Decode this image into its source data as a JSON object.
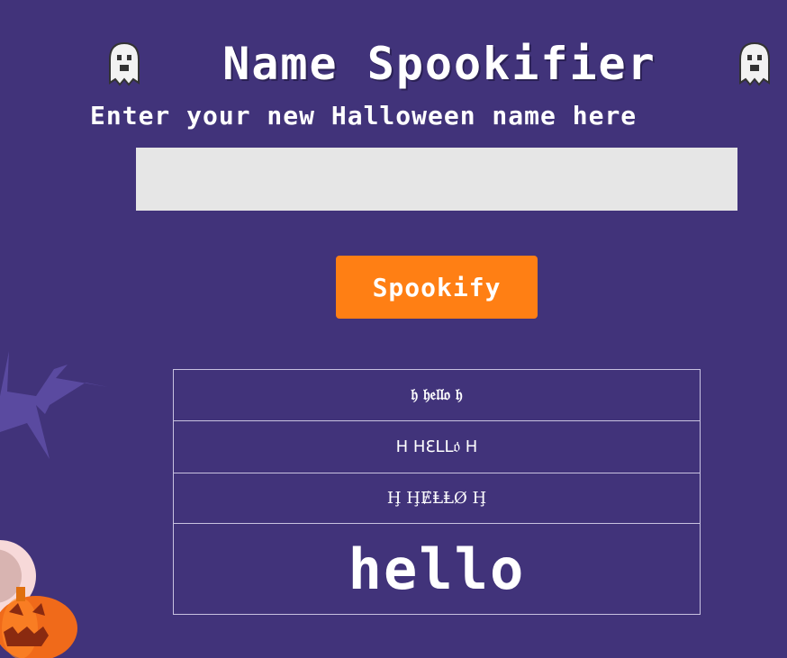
{
  "header": {
    "title": "Name Spookifier",
    "left_icon": "ghost-icon",
    "right_icon": "ghost-icon",
    "subtitle": "Enter your new Halloween name here"
  },
  "form": {
    "input_value": "",
    "input_placeholder": "",
    "button_label": "Spookify"
  },
  "results": [
    {
      "style": "fraktur",
      "text": "𝔥 𝔥𝔢𝔩𝔩𝔬 𝔥"
    },
    {
      "style": "weird",
      "text": "H  HƐLL𝔬̇  H"
    },
    {
      "style": "strike",
      "text": "Ḩ  ḨɆⱠⱠØ  Ḩ"
    },
    {
      "style": "pixel",
      "text": "hello"
    }
  ],
  "colors": {
    "background": "#41337a",
    "button": "#ff7f14",
    "input": "#e6e6e6"
  }
}
